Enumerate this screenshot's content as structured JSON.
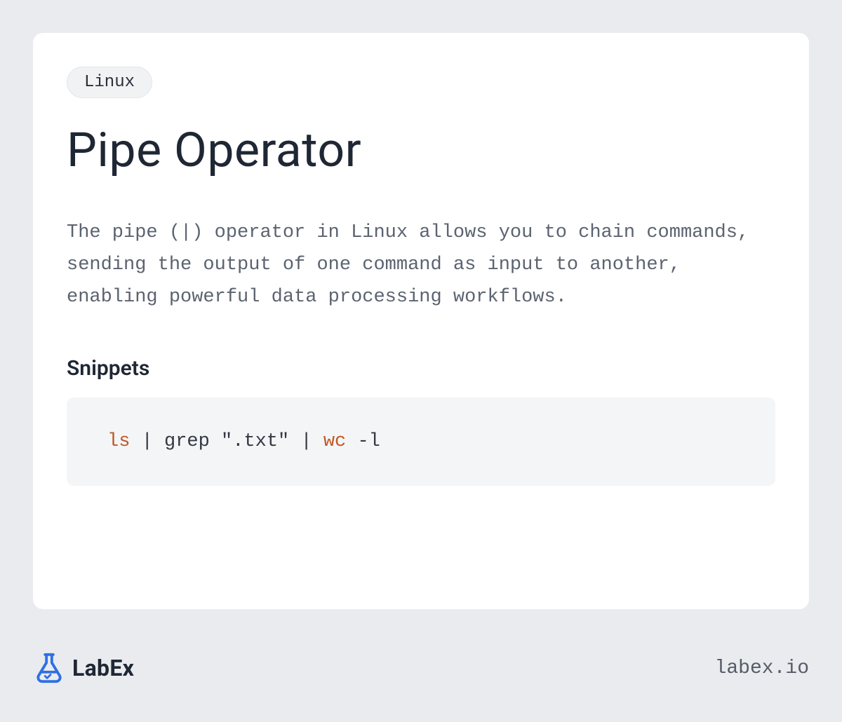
{
  "tag": "Linux",
  "title": "Pipe Operator",
  "description": "The pipe (|) operator in Linux allows you to chain commands, sending the output of one command as input to another, enabling powerful data processing workflows.",
  "snippets_heading": "Snippets",
  "code": {
    "tokens": [
      {
        "text": "ls",
        "cls": "cmd"
      },
      {
        "text": " | grep ",
        "cls": ""
      },
      {
        "text": "\".txt\"",
        "cls": ""
      },
      {
        "text": " | ",
        "cls": ""
      },
      {
        "text": "wc",
        "cls": "cmd"
      },
      {
        "text": " -l",
        "cls": ""
      }
    ]
  },
  "brand": "LabEx",
  "site": "labex.io",
  "colors": {
    "accent": "#2f6fe4",
    "background": "#e9ebee",
    "card": "#ffffff",
    "code_bg": "#f4f5f7",
    "cmd_token": "#c05826"
  }
}
